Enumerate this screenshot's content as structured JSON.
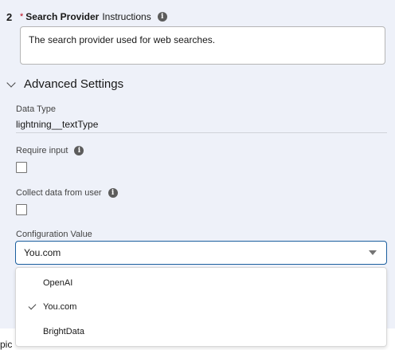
{
  "step": {
    "number": "2"
  },
  "search_provider": {
    "required_mark": "*",
    "label_bold": "Search Provider",
    "label_suffix": "Instructions",
    "info_icon": "info-icon",
    "textarea_value": "The search provider used for web searches."
  },
  "advanced": {
    "header": "Advanced Settings",
    "icon": "chevron-down-icon",
    "data_type_label": "Data Type",
    "data_type_value": "lightning__textType",
    "require_input_label": "Require input",
    "require_input_checked": false,
    "collect_data_label": "Collect data from user",
    "collect_data_checked": false,
    "config_label": "Configuration Value",
    "config_selected": "You.com",
    "options": [
      {
        "label": "OpenAI",
        "selected": false
      },
      {
        "label": "You.com",
        "selected": true
      },
      {
        "label": "BrightData",
        "selected": false
      }
    ]
  },
  "footer_fragment": "pic",
  "colors": {
    "panel_bg": "#eef1f9",
    "focus_border": "#1b5f9e",
    "required": "#ba0517"
  }
}
